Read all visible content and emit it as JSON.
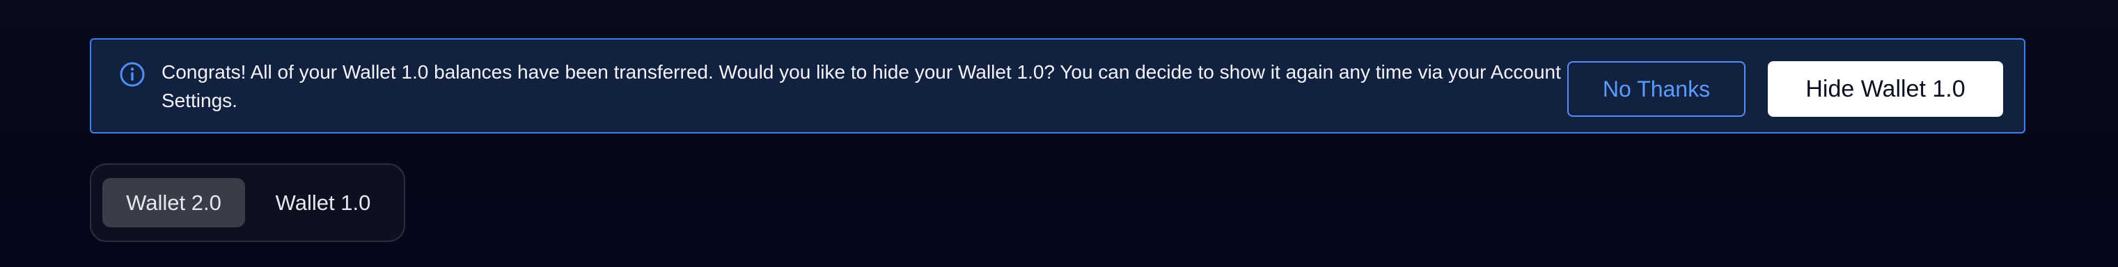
{
  "banner": {
    "icon": "info-icon",
    "message": "Congrats! All of your Wallet 1.0 balances have been transferred. Would you like to hide your Wallet 1.0? You can decide to show it again any time via your Account Settings.",
    "no_thanks_label": "No Thanks",
    "hide_label": "Hide Wallet 1.0",
    "accent_color": "#3d7ff0",
    "background_color": "#12213f"
  },
  "wallet_toggle": {
    "options": [
      {
        "label": "Wallet 2.0",
        "selected": true
      },
      {
        "label": "Wallet 1.0",
        "selected": false
      }
    ]
  }
}
